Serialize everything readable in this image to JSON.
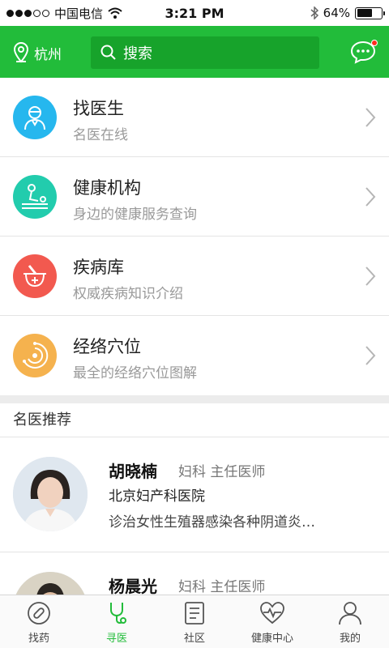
{
  "status_bar": {
    "carrier": "中国电信",
    "time": "3:21 PM",
    "battery": "64%",
    "battery_level": 0.64
  },
  "header": {
    "city": "杭州",
    "search_placeholder": "搜索",
    "message_has_unread": true
  },
  "menu": [
    {
      "title": "找医生",
      "subtitle": "名医在线",
      "icon": "doctor-icon",
      "color": "#26b7ee"
    },
    {
      "title": "健康机构",
      "subtitle": "身边的健康服务查询",
      "icon": "massage-icon",
      "color": "#22ccad"
    },
    {
      "title": "疾病库",
      "subtitle": "权威疾病知识介绍",
      "icon": "mortar-icon",
      "color": "#f2594f"
    },
    {
      "title": "经络穴位",
      "subtitle": "最全的经络穴位图解",
      "icon": "meridian-icon",
      "color": "#f5b24e"
    }
  ],
  "recommend": {
    "title": "名医推荐",
    "doctors": [
      {
        "name": "胡晓楠",
        "dept": "妇科  主任医师",
        "hospital": "北京妇产科医院",
        "desc": "诊治女性生殖器感染各种阴道炎…"
      },
      {
        "name": "杨晨光",
        "dept": "妇科  主任医师",
        "hospital": "",
        "desc": ""
      }
    ]
  },
  "tabs": [
    {
      "label": "找药",
      "icon": "pill-icon",
      "active": false
    },
    {
      "label": "寻医",
      "icon": "stethoscope-icon",
      "active": true
    },
    {
      "label": "社区",
      "icon": "community-icon",
      "active": false
    },
    {
      "label": "健康中心",
      "icon": "heart-pulse-icon",
      "active": false
    },
    {
      "label": "我的",
      "icon": "person-icon",
      "active": false
    }
  ],
  "colors": {
    "brand": "#22bc3a",
    "brand_dark": "#17a32b",
    "unread": "#ff2b1f"
  }
}
